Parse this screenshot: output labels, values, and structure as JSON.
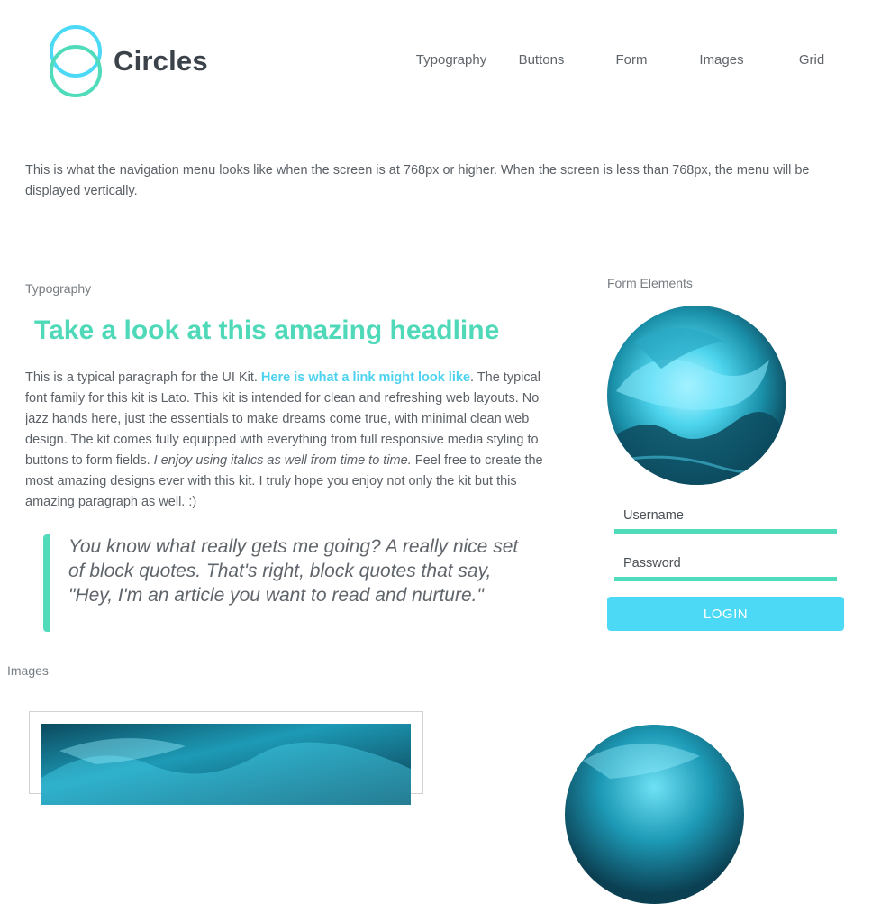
{
  "brand": {
    "name": "Circles",
    "accent": "#4cd9f5",
    "accent_green": "#50dbbb"
  },
  "nav": {
    "items": [
      "Typography",
      "Buttons",
      "Form",
      "Images",
      "Grid"
    ]
  },
  "intro": "This is what the navigation menu looks like when the screen is at 768px or higher. When the screen is less than 768px, the menu will be displayed vertically.",
  "typography": {
    "label": "Typography",
    "headline": "Take a look at this amazing headline",
    "para_start": "This is a typical paragraph for the UI Kit. ",
    "link": "Here is what a link might look like",
    "para_mid": ". The typical font family for this kit is Lato. This kit is intended for clean and refreshing web layouts. No jazz hands here, just the essentials to make dreams come true, with minimal clean web design. The kit comes fully equipped with everything from full responsive media styling to buttons to form fields. ",
    "italic": "I enjoy using italics as well from time to time.",
    "para_end": " Feel free to create the most amazing designs ever with this kit. I truly hope you enjoy not only the kit but this amazing paragraph as well. :)",
    "quote": "You know what really gets me going? A really nice set of block quotes. That's right, block quotes that say, \"Hey, I'm an article you want to read and nurture.\""
  },
  "form": {
    "label": "Form Elements",
    "username_placeholder": "Username",
    "password_placeholder": "Password",
    "login_label": "LOGIN"
  },
  "images": {
    "label": "Images"
  }
}
